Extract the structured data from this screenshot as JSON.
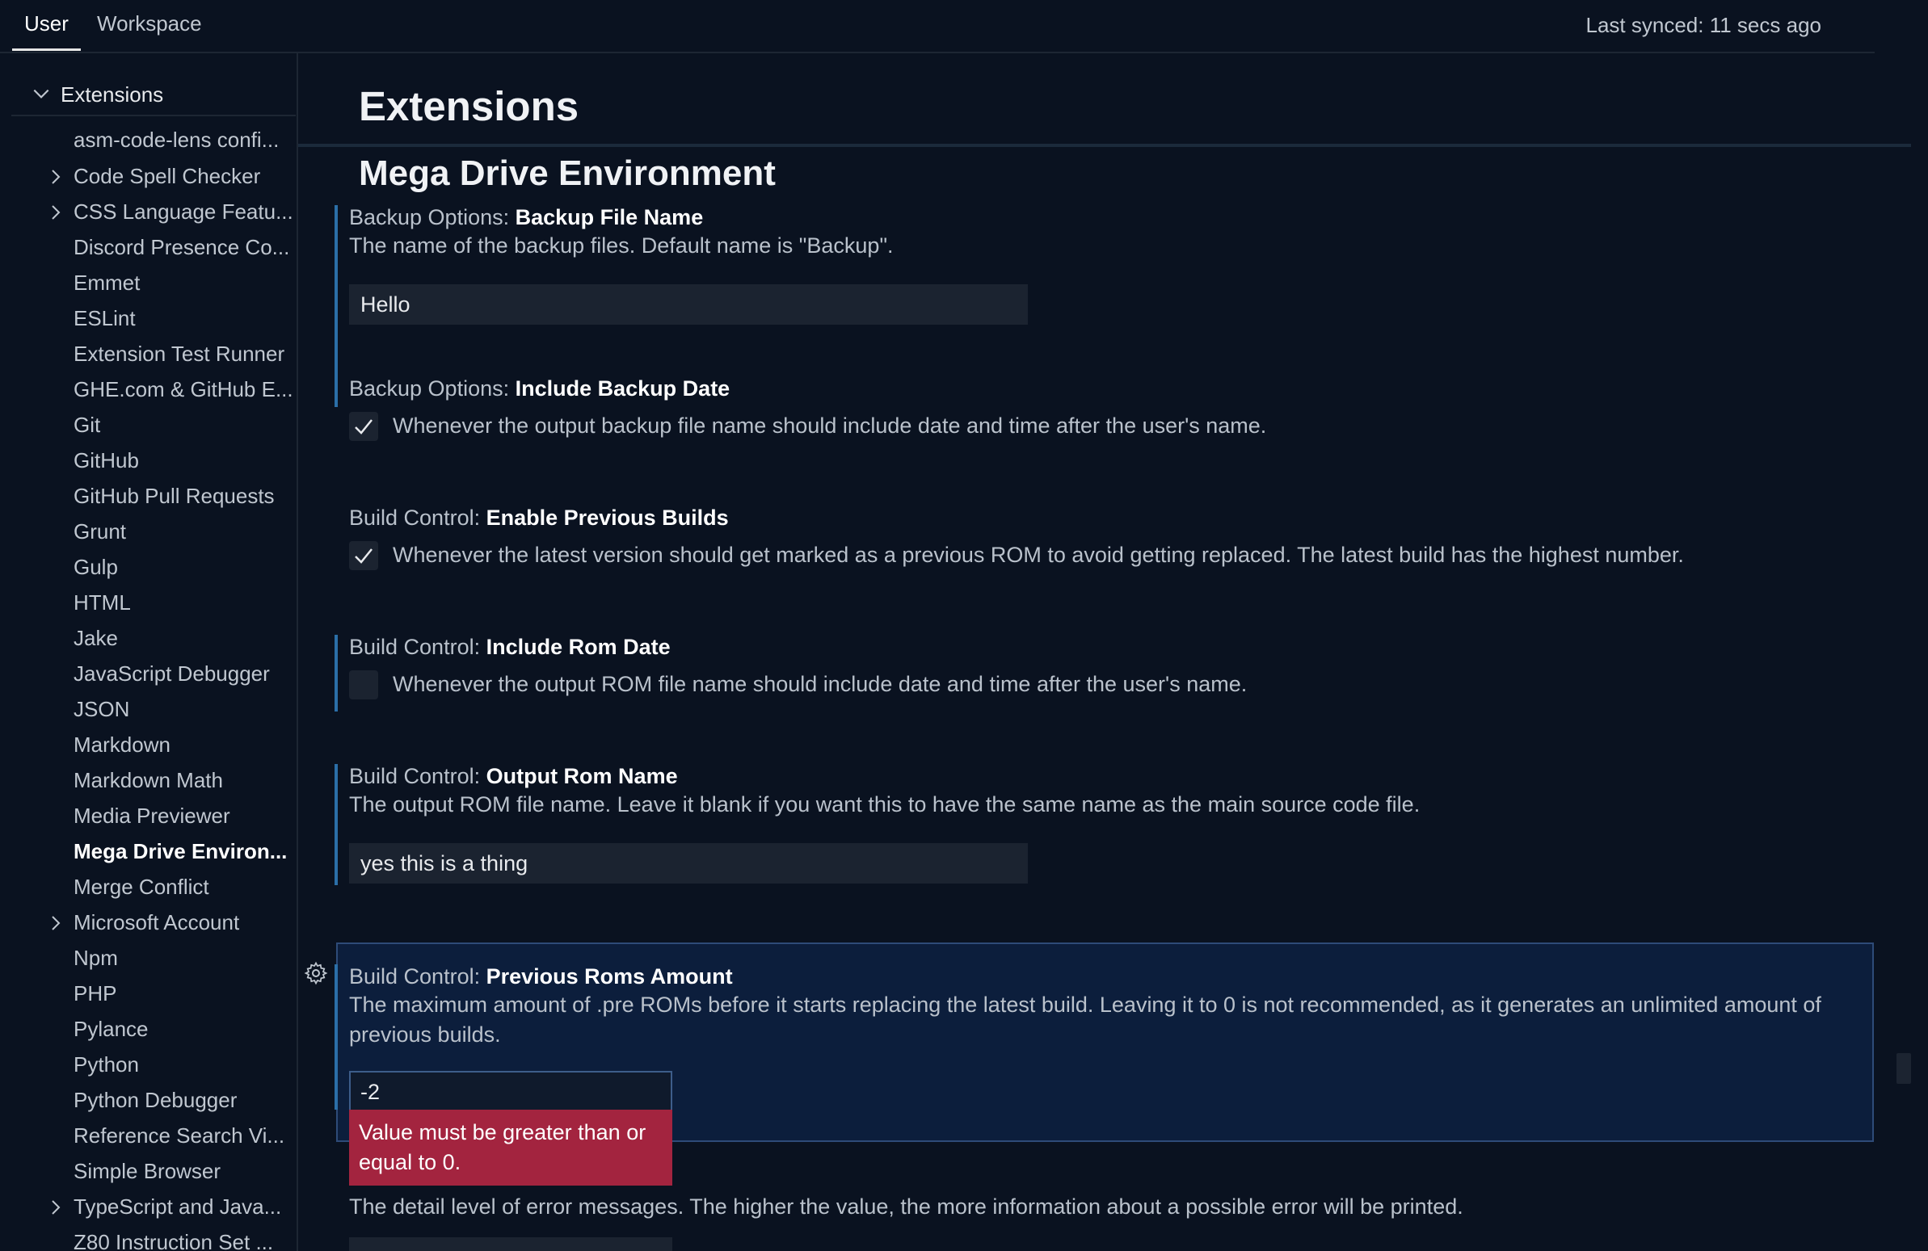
{
  "tabs": {
    "user": "User",
    "workspace": "Workspace",
    "synced": "Last synced: 11 secs ago"
  },
  "sidebar": {
    "root": "Extensions",
    "items": [
      {
        "label": "asm-code-lens confi...",
        "expandable": false
      },
      {
        "label": "Code Spell Checker",
        "expandable": true
      },
      {
        "label": "CSS Language Featu...",
        "expandable": true
      },
      {
        "label": "Discord Presence Co...",
        "expandable": false
      },
      {
        "label": "Emmet",
        "expandable": false
      },
      {
        "label": "ESLint",
        "expandable": false
      },
      {
        "label": "Extension Test Runner",
        "expandable": false
      },
      {
        "label": "GHE.com & GitHub E...",
        "expandable": false
      },
      {
        "label": "Git",
        "expandable": false
      },
      {
        "label": "GitHub",
        "expandable": false
      },
      {
        "label": "GitHub Pull Requests",
        "expandable": false
      },
      {
        "label": "Grunt",
        "expandable": false
      },
      {
        "label": "Gulp",
        "expandable": false
      },
      {
        "label": "HTML",
        "expandable": false
      },
      {
        "label": "Jake",
        "expandable": false
      },
      {
        "label": "JavaScript Debugger",
        "expandable": false
      },
      {
        "label": "JSON",
        "expandable": false
      },
      {
        "label": "Markdown",
        "expandable": false
      },
      {
        "label": "Markdown Math",
        "expandable": false
      },
      {
        "label": "Media Previewer",
        "expandable": false
      },
      {
        "label": "Mega Drive Environ...",
        "expandable": false,
        "active": true
      },
      {
        "label": "Merge Conflict",
        "expandable": false
      },
      {
        "label": "Microsoft Account",
        "expandable": true
      },
      {
        "label": "Npm",
        "expandable": false
      },
      {
        "label": "PHP",
        "expandable": false
      },
      {
        "label": "Pylance",
        "expandable": false
      },
      {
        "label": "Python",
        "expandable": false
      },
      {
        "label": "Python Debugger",
        "expandable": false
      },
      {
        "label": "Reference Search Vi...",
        "expandable": false
      },
      {
        "label": "Simple Browser",
        "expandable": false
      },
      {
        "label": "TypeScript and Java...",
        "expandable": true
      },
      {
        "label": "Z80 Instruction Set ...",
        "expandable": false
      }
    ]
  },
  "main": {
    "title": "Extensions",
    "section": "Mega Drive Environment",
    "settings": {
      "backup_name": {
        "category": "Backup Options: ",
        "name": "Backup File Name",
        "desc": "The name of the backup files. Default name is \"Backup\".",
        "value": "Hello"
      },
      "backup_date": {
        "category": "Backup Options: ",
        "name": "Include Backup Date",
        "desc": "Whenever the output backup file name should include date and time after the user's name.",
        "checked": true
      },
      "prev_builds": {
        "category": "Build Control: ",
        "name": "Enable Previous Builds",
        "desc": "Whenever the latest version should get marked as a previous ROM to avoid getting replaced. The latest build has the highest number.",
        "checked": true
      },
      "rom_date": {
        "category": "Build Control: ",
        "name": "Include Rom Date",
        "desc": "Whenever the output ROM file name should include date and time after the user's name.",
        "checked": false
      },
      "rom_name": {
        "category": "Build Control: ",
        "name": "Output Rom Name",
        "desc": "The output ROM file name. Leave it blank if you want this to have the same name as the main source code file.",
        "value": "yes this is a thing"
      },
      "prev_amount": {
        "category": "Build Control: ",
        "name": "Previous Roms Amount",
        "desc": "The maximum amount of .pre ROMs before it starts replacing the latest build. Leaving it to 0 is not recommended, as it generates an unlimited amount of previous builds.",
        "value": "-2",
        "error": "Value must be greater than or equal to 0."
      },
      "error_level": {
        "desc": "The detail level of error messages. The higher the value, the more information about a possible error will be printed."
      }
    }
  }
}
